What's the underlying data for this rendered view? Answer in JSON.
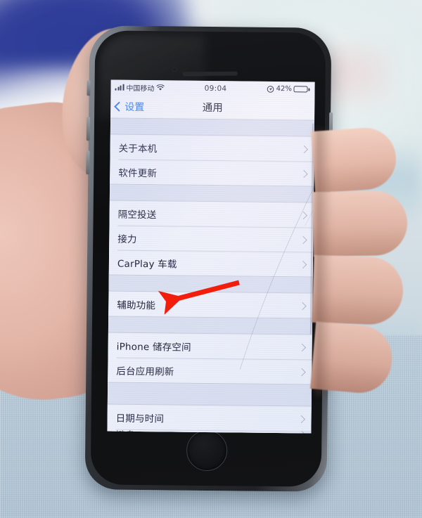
{
  "device": {
    "name": "iPhone",
    "home_button": "home-button",
    "earpiece": "earpiece-speaker"
  },
  "status_bar": {
    "signal_icon": "signal-bars-icon",
    "signal_bars_filled": 4,
    "carrier": "中国移动",
    "wifi_icon": "wifi-icon",
    "time": "09:04",
    "location_icon": "location-services-icon",
    "battery_percent": "42%",
    "battery_level": 42,
    "battery_icon": "battery-icon"
  },
  "nav_bar": {
    "back_label": "设置",
    "back_icon": "chevron-left-icon",
    "title": "通用"
  },
  "groups": [
    {
      "id": "group-device",
      "rows": [
        {
          "label": "关于本机",
          "accessory": "chevron-right-icon"
        },
        {
          "label": "软件更新",
          "accessory": "chevron-right-icon"
        }
      ]
    },
    {
      "id": "group-continuity",
      "rows": [
        {
          "label": "隔空投送",
          "accessory": "chevron-right-icon"
        },
        {
          "label": "接力",
          "accessory": "chevron-right-icon"
        },
        {
          "label": "CarPlay 车载",
          "accessory": "chevron-right-icon"
        }
      ]
    },
    {
      "id": "group-accessibility",
      "rows": [
        {
          "label": "辅助功能",
          "accessory": "chevron-right-icon"
        }
      ]
    },
    {
      "id": "group-storage",
      "rows": [
        {
          "label": "iPhone 储存空间",
          "accessory": "chevron-right-icon"
        },
        {
          "label": "后台应用刷新",
          "accessory": "chevron-right-icon"
        }
      ]
    },
    {
      "id": "group-datetime",
      "rows": [
        {
          "label": "日期与时间",
          "accessory": "chevron-right-icon"
        },
        {
          "label": "键盘",
          "accessory": "chevron-right-icon"
        }
      ]
    }
  ],
  "annotation": {
    "arrow_color": "#f21d0d",
    "points_at": "辅助功能"
  },
  "colors": {
    "accent_blue": "#2e7bf6",
    "list_background": "#e4e8f4",
    "cell_background": "#eef1fa",
    "separator": "#cdd2e0",
    "text_primary": "#20203a"
  }
}
